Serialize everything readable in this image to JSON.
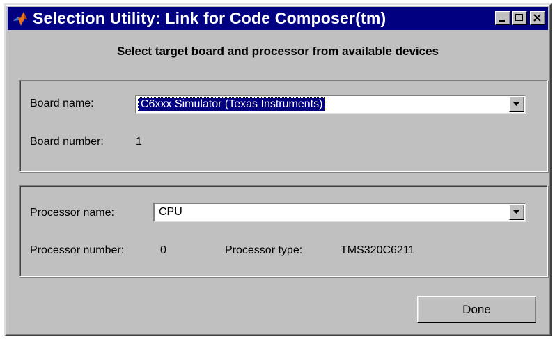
{
  "window": {
    "title": "Selection Utility: Link for Code Composer(tm)",
    "app_icon": "matlab-logo-icon",
    "controls": [
      "minimize-icon",
      "maximize-icon",
      "close-icon"
    ]
  },
  "heading": "Select target board and processor from available devices",
  "board": {
    "name_label": "Board name:",
    "name_value": "C6xxx Simulator (Texas Instruments)",
    "number_label": "Board number:",
    "number_value": "1"
  },
  "processor": {
    "name_label": "Processor name:",
    "name_value": "CPU",
    "number_label": "Processor number:",
    "number_value": "0",
    "type_label": "Processor type:",
    "type_value": "TMS320C6211"
  },
  "actions": {
    "done_label": "Done"
  },
  "colors": {
    "titlebar": "#000080",
    "face": "#c0c0c0",
    "selection": "#000080"
  }
}
